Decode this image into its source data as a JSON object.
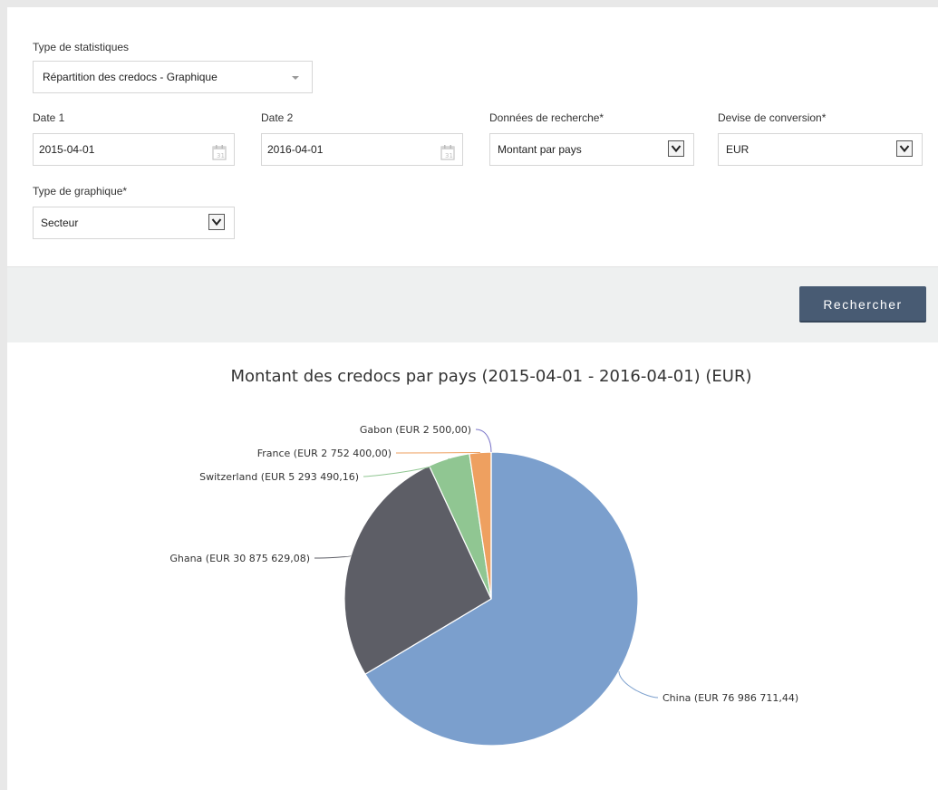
{
  "form": {
    "stats_type_label": "Type de statistiques",
    "stats_type_value": "Répartition des credocs - Graphique",
    "date1_label": "Date 1",
    "date1_value": "2015-04-01",
    "date2_label": "Date 2",
    "date2_value": "2016-04-01",
    "search_data_label": "Données de recherche*",
    "search_data_value": "Montant par pays",
    "currency_label": "Devise de conversion*",
    "currency_value": "EUR",
    "chart_type_label": "Type de graphique*",
    "chart_type_value": "Secteur"
  },
  "actions": {
    "search_label": "Rechercher"
  },
  "icons": {
    "calendar": "calendar-icon",
    "dropdown": "chevron-down-icon"
  },
  "chart_data": {
    "type": "pie",
    "title": "Montant des credocs par pays (2015-04-01 - 2016-04-01) (EUR)",
    "slices": [
      {
        "name": "China",
        "value": 76986711.44,
        "label": "China (EUR 76 986 711,44)",
        "color": "#7b9fcd"
      },
      {
        "name": "Ghana",
        "value": 30875629.08,
        "label": "Ghana (EUR 30 875 629,08)",
        "color": "#5d5e66"
      },
      {
        "name": "Switzerland",
        "value": 5293490.16,
        "label": "Switzerland (EUR 5 293 490,16)",
        "color": "#90c692"
      },
      {
        "name": "France",
        "value": 2752400.0,
        "label": "France (EUR 2 752 400,00)",
        "color": "#eea060"
      },
      {
        "name": "Gabon",
        "value": 2500.0,
        "label": "Gabon (EUR 2 500,00)",
        "color": "#7b76c9"
      }
    ]
  }
}
